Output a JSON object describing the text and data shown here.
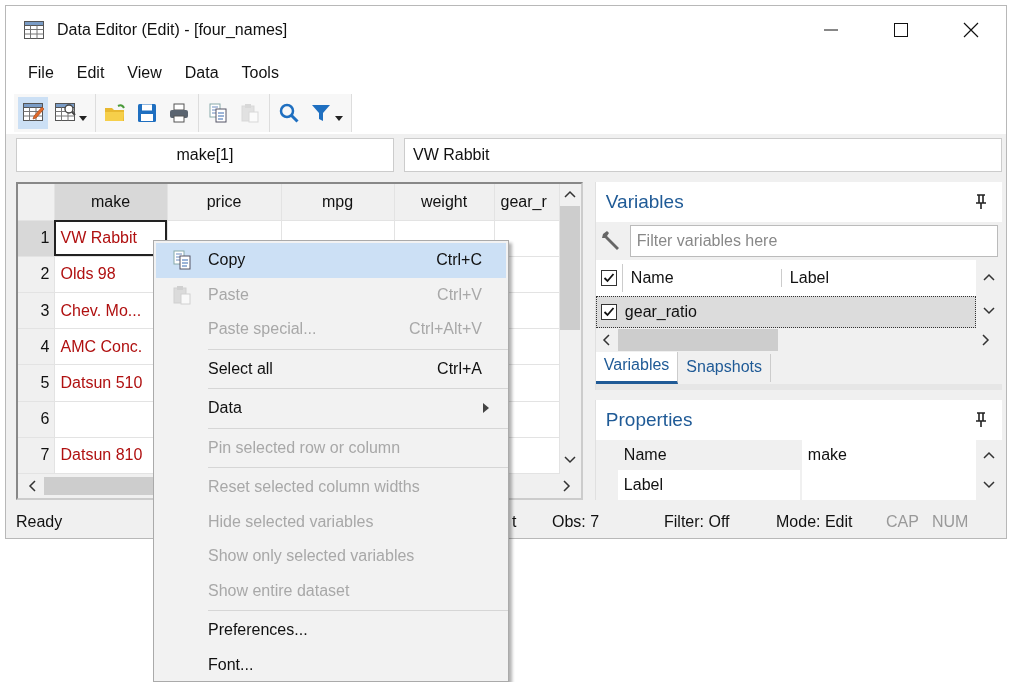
{
  "window": {
    "title": "Data Editor (Edit) - [four_names]"
  },
  "menu_bar": [
    "File",
    "Edit",
    "View",
    "Data",
    "Tools"
  ],
  "toolbar": [
    [
      {
        "kind": "edit",
        "selected": true,
        "dropdown": false,
        "disabled": false
      },
      {
        "kind": "browse",
        "selected": false,
        "dropdown": true,
        "disabled": false
      }
    ],
    [
      {
        "kind": "open",
        "selected": false,
        "dropdown": false,
        "disabled": false
      },
      {
        "kind": "save",
        "selected": false,
        "dropdown": false,
        "disabled": false
      },
      {
        "kind": "print",
        "selected": false,
        "dropdown": false,
        "disabled": false
      }
    ],
    [
      {
        "kind": "copy",
        "selected": false,
        "dropdown": false,
        "disabled": false
      },
      {
        "kind": "paste",
        "selected": false,
        "dropdown": false,
        "disabled": true
      }
    ],
    [
      {
        "kind": "find",
        "selected": false,
        "dropdown": false,
        "disabled": false
      },
      {
        "kind": "filter",
        "selected": false,
        "dropdown": true,
        "disabled": false
      }
    ]
  ],
  "cell_reference": "make[1]",
  "cell_value": "VW Rabbit",
  "grid": {
    "columns": [
      {
        "label": "make",
        "selected": true
      },
      {
        "label": "price",
        "selected": false
      },
      {
        "label": "mpg",
        "selected": false
      },
      {
        "label": "weight",
        "selected": false
      },
      {
        "label": "gear_r",
        "selected": false
      }
    ],
    "rows": [
      {
        "number": "1",
        "selected": true,
        "cells": [
          {
            "text": "VW Rabbit",
            "kind": "string",
            "selected": true
          }
        ]
      },
      {
        "number": "2",
        "selected": false,
        "cells": [
          {
            "text": "Olds 98",
            "kind": "string",
            "selected": false
          }
        ]
      },
      {
        "number": "3",
        "selected": false,
        "cells": [
          {
            "text": "Chev. Mo...",
            "kind": "string",
            "selected": false
          }
        ]
      },
      {
        "number": "4",
        "selected": false,
        "cells": [
          {
            "text": "AMC Conc.",
            "kind": "string",
            "selected": false
          }
        ]
      },
      {
        "number": "5",
        "selected": false,
        "cells": [
          {
            "text": "Datsun 510",
            "kind": "string",
            "selected": false
          }
        ]
      },
      {
        "number": "6",
        "selected": false,
        "cells": []
      },
      {
        "number": "7",
        "selected": false,
        "cells": [
          {
            "text": "Datsun 810",
            "kind": "string",
            "selected": false
          }
        ]
      }
    ]
  },
  "variables": {
    "title": "Variables",
    "filter": {
      "placeholder": "Filter variables here"
    },
    "header": {
      "checked": true,
      "columns": [
        "Name",
        "Label"
      ]
    },
    "items": [
      {
        "name": "gear_ratio",
        "checked": true,
        "selected": true
      }
    ],
    "tabs": [
      {
        "label": "Variables",
        "selected": true
      },
      {
        "label": "Snapshots",
        "selected": false
      }
    ]
  },
  "properties": {
    "title": "Properties",
    "rows": [
      {
        "name": "Name",
        "value": "make"
      },
      {
        "name": "Label"
      }
    ]
  },
  "status_bar": [
    {
      "text": "Ready",
      "disabled": false
    },
    {
      "text": "t",
      "disabled": false
    },
    {
      "text": "Obs: 7",
      "disabled": false
    },
    {
      "text": "Filter: Off",
      "disabled": false
    },
    {
      "text": "Mode: Edit",
      "disabled": false
    },
    {
      "text": "CAP",
      "disabled": true
    },
    {
      "text": "NUM",
      "disabled": true
    }
  ],
  "context_menu": [
    {
      "kind": "item",
      "label": "Copy",
      "shortcut": "Ctrl+C",
      "disabled": false,
      "selected": true,
      "submenu": false
    },
    {
      "kind": "item",
      "label": "Paste",
      "shortcut": "Ctrl+V",
      "disabled": true,
      "selected": false,
      "submenu": false
    },
    {
      "kind": "item",
      "label": "Paste special...",
      "shortcut": "Ctrl+Alt+V",
      "disabled": true,
      "selected": false,
      "submenu": false
    },
    {
      "kind": "separator"
    },
    {
      "kind": "item",
      "label": "Select all",
      "shortcut": "Ctrl+A",
      "disabled": false,
      "selected": false,
      "submenu": false
    },
    {
      "kind": "separator"
    },
    {
      "kind": "item",
      "label": "Data",
      "disabled": false,
      "selected": false,
      "submenu": true
    },
    {
      "kind": "separator"
    },
    {
      "kind": "item",
      "label": "Pin selected row or column",
      "disabled": true,
      "selected": false,
      "submenu": false
    },
    {
      "kind": "separator"
    },
    {
      "kind": "item",
      "label": "Reset selected column widths",
      "disabled": true,
      "selected": false,
      "submenu": false
    },
    {
      "kind": "item",
      "label": "Hide selected variables",
      "disabled": true,
      "selected": false,
      "submenu": false
    },
    {
      "kind": "item",
      "label": "Show only selected variables",
      "disabled": true,
      "selected": false,
      "submenu": false
    },
    {
      "kind": "item",
      "label": "Show entire dataset",
      "disabled": true,
      "selected": false,
      "submenu": false
    },
    {
      "kind": "separator"
    },
    {
      "kind": "item",
      "label": "Preferences...",
      "disabled": false,
      "selected": false,
      "submenu": false
    },
    {
      "kind": "item",
      "label": "Font...",
      "disabled": false,
      "selected": false,
      "submenu": false
    }
  ]
}
